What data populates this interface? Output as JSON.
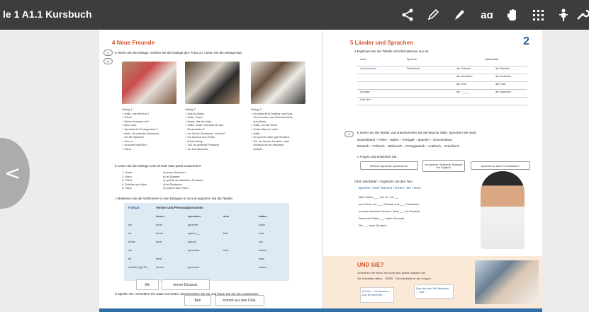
{
  "app": {
    "title": "le 1 A1.1 Kursbuch"
  },
  "toolbar": {
    "icons": [
      "share-icon",
      "pen-icon",
      "highlighter-icon",
      "text-size-icon",
      "hand-icon",
      "grid-icon",
      "pointer-icon",
      "wrench-icon"
    ],
    "text_size_label": "aɑ"
  },
  "navigation": {
    "prev_label": "<"
  },
  "left_page": {
    "section_title": "4  Neue Freunde",
    "instr_a": "a  Hören Sie die Dialoge. Ordnen Sie die Dialoge den Fotos zu. Lesen Sie die Dialoge laut.",
    "photo_labels": [
      "1",
      "2",
      "3"
    ],
    "dialog1": "Dialog 1\n○ Hallo, wie heißt du?\n○ Pablo.\n○ Woher kommst du?\n○ Aus León.\n○ Sprichst du Portugiesisch?\n○ Nein, ich spreche Spanisch,\n   Ich bin Spanier!\n○ Ach so.\n○ Und wie heißt du?\n○ Karin.",
    "dialog2": "Dialog 2\n○ Das ist Dana.\n○ Hallo, Dana.\n○ Dana, das ist Karin.\n○ Hallo, Karin. Kommst du aus\n   Deutschland?\n○ Ja, ich bin Deutsche. Und du?\n○ Ich komme aus Polen.\n○ Dziań dobry.\n○ Toll, du sprichst Polnisch!\n○ Ja, ein bisschen.",
    "dialog3": "Dialog 3\n○ Und das sind Dobilaz und Kyra.\n   Sie kommen aus Griechenland,\n   aus Athen.\n○ Hallo, ich bin Karin.\n○ Guten Abend, Karin.\n○ Hallo.\n○ Ihr sprecht aber gut Deutsch.\n○ Oh, wir lernen Deutsch, aber\n   Deutsch ist ein bisschen\n   schwer.",
    "instr_b": "b  Lesen Sie die Dialoge noch einmal. Was passt zusammen?",
    "match_left": "1. Dana\n2. Karin\n3. Pablo\n4. Dobilaz und Kyra\n5. Karin",
    "match_right": "a) lernen Deutsch.\nb) ist Spanier.\nc) spricht ein bisschen Polnisch.\nd) ist Deutsche.\ne) kommt aus Polen.",
    "instr_c": "c  Markieren Sie die Verbformen in den Dialogen in 4a und ergänzen Sie die Tabelle.",
    "table": {
      "headers": [
        "FOKUS",
        "Verben und Personalpronomen"
      ],
      "rows": [
        [
          "",
          "lernen",
          "sprechen",
          "sein",
          "haben"
        ],
        [
          "ich",
          "lerne",
          "spreche",
          "",
          "habe"
        ],
        [
          "du",
          "lernst",
          "sprich___",
          "bist",
          "hast"
        ],
        [
          "er/sie",
          "lernt",
          "spricht",
          "",
          "hat"
        ],
        [
          "wir",
          "",
          "sprechen",
          "sind",
          "haben"
        ],
        [
          "ihr",
          "lernt",
          "",
          "",
          "habt"
        ],
        [
          "sie/Sie (Sg./Pl.)",
          "lernen",
          "sprechen",
          "",
          "haben"
        ]
      ]
    },
    "instr_d": "d  Spielen Sie. Schreiben Sie Sätze auf Zettel. Zerschneiden Sie sie und legen Sie sie neu zusammen.",
    "answer_wir": "Wir",
    "answer_lernen": "lernen Deutsch.",
    "answer_ben": "Ben",
    "answer_kommt": "kommt aus den USA."
  },
  "right_page": {
    "section_title": "5  Länder und Sprachen",
    "page_number": "2",
    "instr_a": "a  Ergänzen Sie die Tabelle mit Informationen aus 4a.",
    "table_headers": [
      "Land",
      "Sprache",
      "Nationalität"
    ],
    "table_rows": [
      [
        "Griechenland",
        "Griechisch",
        "der Grieche",
        "die Griechin"
      ],
      [
        "",
        "",
        "der Deutsche",
        "die Deutsche"
      ],
      [
        "",
        "",
        "der Pole",
        "die Polin"
      ],
      [
        "Spanien",
        "",
        "der ______",
        "die Spanierin"
      ],
      [
        "Und Sie?",
        "",
        "",
        ""
      ]
    ],
    "instr_b": "b  Hören Sie die Wörter und unterstreichen Sie die betonte Silbe. Sprechen Sie nach.",
    "words_1": "Deutschland – Polen – Italien – Portugal – Spanien – Griechenland",
    "words_2": "Deutsch – Polnisch – Italienisch – Portugiesisch – Arabisch – Griechisch",
    "instr_c": "c  Fragen und antworten Sie.",
    "bubble_1": "Welche Sprachen sprichst du?",
    "bubble_2": "Ich spreche Ukrainisch, Russisch und Englisch.",
    "bubble_3": "Sprichst du auch Französisch?",
    "instr_d": "d  Ein Steckbrief – Ergänzen Sie den Text.",
    "word_box": "spreche  •  sind  •  komme  •  lernen  •  bin  •  lerne",
    "fill_text": "Mein Name ___ Yan Ju. Ich ___\naus China. Ich ___ Chinese und ___ Chinesisch\nund ein bisschen Deutsch. Jetzt ___ ich Deutsch.\nDana und Pablo ___ meine Freunde.\nSie ___ auch Deutsch.",
    "und_sie_title": "UND SIE?",
    "und_sie_text": "Schreiben Sie einen Text über sich selbst. Wählen Sie.\nSie schreiben allein.   ODER   Sie schreiben in der Gruppe.",
    "note_1": "Ich bin ...\nIch komme ... und\nich spreche ...",
    "note_2": "Das sind wir.\nWir kommen ... und ..."
  },
  "colors": {
    "topbar": "#3d3d3d",
    "section_title": "#d2542c",
    "page_number": "#2a5d8f",
    "table_bg": "#dde9f3",
    "und_sie_bg": "#fbe9d8"
  }
}
